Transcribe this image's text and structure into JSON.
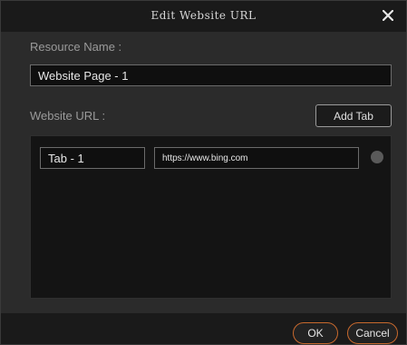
{
  "dialog": {
    "title": "Edit Website URL",
    "close_icon": "close-icon"
  },
  "form": {
    "resource_name_label": "Resource Name :",
    "resource_name_value": "Website Page - 1",
    "website_url_label": "Website URL :",
    "add_tab_label": "Add Tab"
  },
  "tabs": [
    {
      "name": "Tab - 1",
      "url": "https://www.bing.com"
    }
  ],
  "footer": {
    "ok_label": "OK",
    "cancel_label": "Cancel"
  },
  "colors": {
    "accent": "#c8692d",
    "background": "#2b2b2b",
    "field_background": "#0f0f0f"
  }
}
